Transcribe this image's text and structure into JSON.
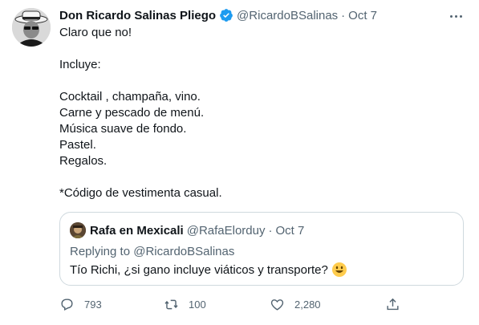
{
  "author": {
    "name": "Don Ricardo Salinas Pliego",
    "handle": "@RicardoBSalinas",
    "separator": "·",
    "date": "Oct 7"
  },
  "tweet": {
    "lines": [
      "Claro que no!",
      "",
      "Incluye:",
      "",
      "Cocktail , champaña, vino.",
      "Carne y pescado de menú.",
      "Música suave de fondo.",
      "Pastel.",
      "Regalos.",
      "",
      "*Código de vestimenta casual."
    ]
  },
  "quote": {
    "name": "Rafa en Mexicali",
    "handle": "@RafaElorduy",
    "separator": "·",
    "date": "Oct 7",
    "replying_label": "Replying to",
    "replying_to": "@RicardoBSalinas",
    "text": "Tío Richi, ¿si gano incluye viáticos y transporte?"
  },
  "actions": {
    "replies": "793",
    "retweets": "100",
    "likes": "2,280"
  },
  "colors": {
    "text": "#0f1419",
    "muted": "#536471",
    "verified": "#1d9bf0",
    "border": "#cfd9de"
  },
  "icons": [
    "verified-badge-icon",
    "more-icon",
    "reply-icon",
    "retweet-icon",
    "like-icon",
    "share-icon",
    "smiley-emoji-icon"
  ]
}
